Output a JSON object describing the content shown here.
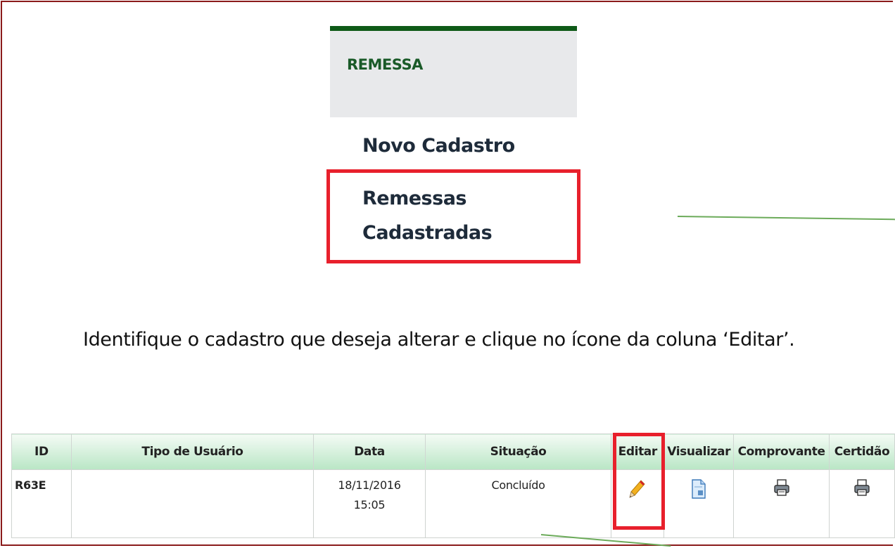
{
  "menu": {
    "header": "REMESSA",
    "items": [
      "Novo Cadastro",
      "Remessas",
      "Cadastradas"
    ]
  },
  "instruction": "Identifique o cadastro que deseja alterar e clique no ícone da coluna ‘Editar’.",
  "table": {
    "headers": [
      "ID",
      "Tipo de Usuário",
      "Data",
      "Situação",
      "Editar",
      "Visualizar",
      "Comprovante",
      "Certidão"
    ],
    "rows": [
      {
        "id": "R63E",
        "tipo": "",
        "data_date": "18/11/2016",
        "data_time": "15:05",
        "situacao": "Concluído"
      }
    ]
  },
  "icons": {
    "editar": "pencil-icon",
    "visualizar": "document-icon",
    "comprovante": "printer-icon",
    "certidao": "printer-icon"
  },
  "colors": {
    "highlight": "#e8202c",
    "menu_accent": "#0e5a17",
    "header_gradient_end": "#b9e6c5"
  }
}
